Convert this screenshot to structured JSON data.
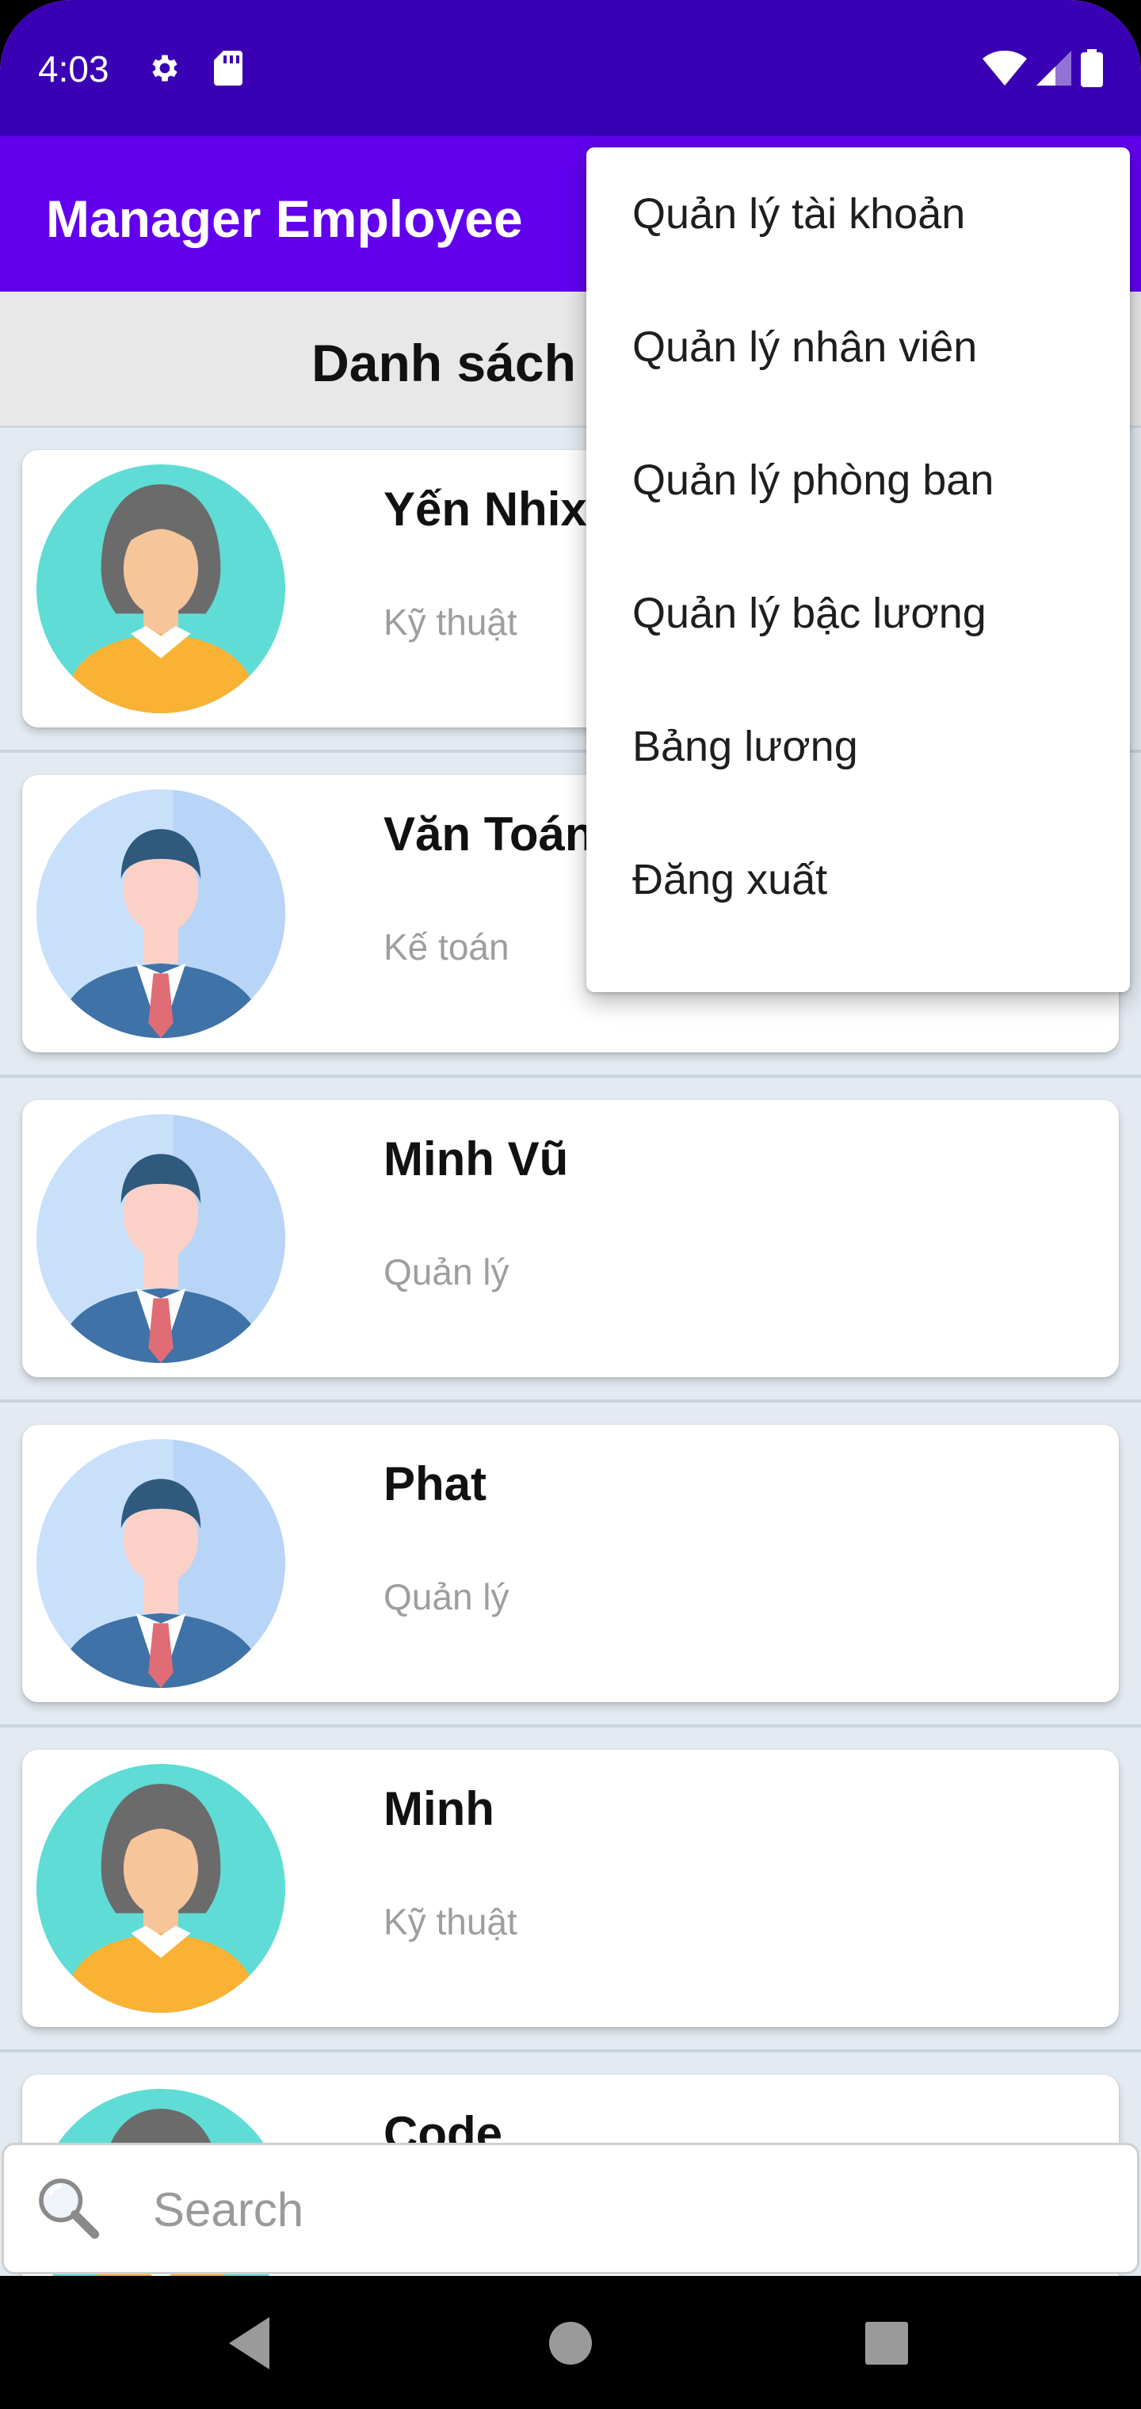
{
  "status_bar": {
    "time": "4:03"
  },
  "app_bar": {
    "title": "Manager Employee"
  },
  "list_header": {
    "title": "Danh sách"
  },
  "employees": [
    {
      "name": "Yến Nhixx",
      "department": "Kỹ thuật",
      "avatar": "female-avatar-icon"
    },
    {
      "name": "Văn Toán",
      "department": "Kế toán",
      "avatar": "male-avatar-icon"
    },
    {
      "name": "Minh Vũ",
      "department": "Quản lý",
      "avatar": "male-avatar-icon"
    },
    {
      "name": "Phat",
      "department": "Quản lý",
      "avatar": "male-avatar-icon"
    },
    {
      "name": "Minh",
      "department": "Kỹ thuật",
      "avatar": "female-avatar-icon"
    },
    {
      "name": "Code",
      "department": "",
      "avatar": "female-avatar-icon"
    }
  ],
  "search": {
    "placeholder": "Search"
  },
  "menu": {
    "items": [
      "Quản lý tài khoản",
      "Quản lý nhân viên",
      "Quản lý phòng ban",
      "Quản lý bậc lương",
      "Bảng lương",
      "Đăng xuất"
    ]
  },
  "colors": {
    "status_bar": "#3a00b3",
    "app_bar": "#6200ee",
    "female_avatar_bg": "#5fdcd5",
    "male_avatar_bg": "#c9e0fb"
  }
}
